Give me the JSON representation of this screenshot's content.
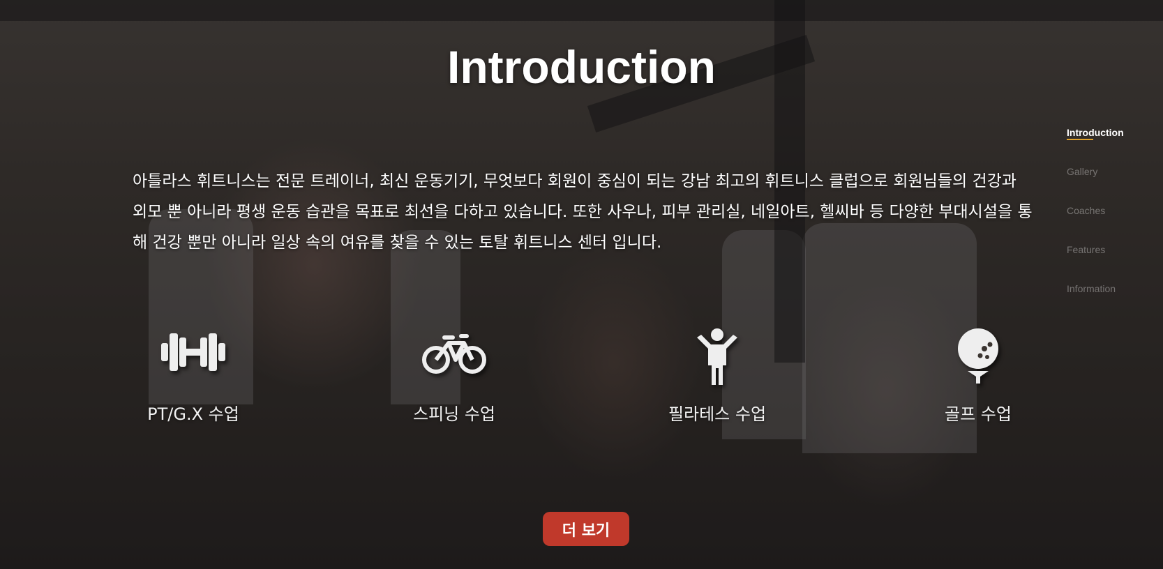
{
  "section": {
    "title": "Introduction",
    "description": "아틀라스 휘트니스는 전문 트레이너, 최신 운동기기, 무엇보다 회원이 중심이 되는 강남 최고의 휘트니스 클럽으로 회원님들의 건강과 외모 뿐 아니라 평생 운동 습관을 목표로 최선을 다하고 있습니다. 또한 사우나, 피부 관리실, 네일아트, 헬씨바 등 다양한 부대시설을 통해 건강 뿐만 아니라 일상 속의 여유를 찾을 수 있는 토탈 휘트니스 센터 입니다."
  },
  "side_nav": {
    "items": [
      {
        "label": "Introduction",
        "active": true
      },
      {
        "label": "Gallery",
        "active": false
      },
      {
        "label": "Coaches",
        "active": false
      },
      {
        "label": "Features",
        "active": false
      },
      {
        "label": "Information",
        "active": false
      }
    ],
    "accent_color": "#e0a22c"
  },
  "features": [
    {
      "icon": "dumbbell-icon",
      "label": "PT/G.X 수업"
    },
    {
      "icon": "bicycle-icon",
      "label": "스피닝 수업"
    },
    {
      "icon": "person-icon",
      "label": "필라테스 수업"
    },
    {
      "icon": "golf-ball-icon",
      "label": "골프 수업"
    }
  ],
  "more_button": {
    "label": "더 보기",
    "color": "#c0392b"
  }
}
